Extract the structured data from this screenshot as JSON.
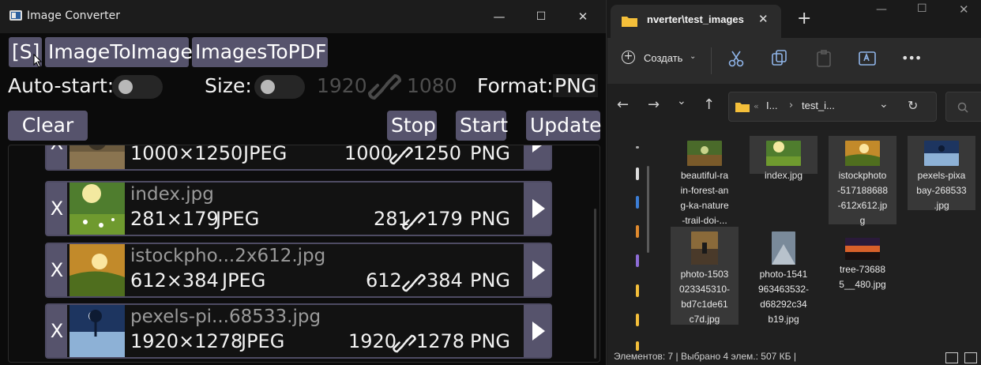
{
  "app": {
    "title": "Image Converter",
    "window_controls": {
      "minimize": "—",
      "maximize": "☐",
      "close": "✕"
    },
    "tabs": [
      "[S]",
      "ImageToImage",
      "ImagesToPDF"
    ],
    "auto_start_label": "Auto-start:",
    "size_label": "Size:",
    "size_width": "1920",
    "size_height": "1080",
    "format_label": "Format:",
    "format_value": "PNG",
    "buttons": {
      "clear_all": "Clear all",
      "stop": "Stop",
      "start": "Start",
      "update": "Update"
    },
    "items": [
      {
        "name": "",
        "x": "X",
        "src_dims": "1000×1250",
        "src_fmt": "JPEG",
        "out_w": "1000",
        "out_h": "1250",
        "out_fmt": "PNG"
      },
      {
        "name": "index.jpg",
        "x": "X",
        "src_dims": "281×179",
        "src_fmt": "JPEG",
        "out_w": "281",
        "out_h": "179",
        "out_fmt": "PNG"
      },
      {
        "name": "istockpho...2x612.jpg",
        "x": "X",
        "src_dims": "612×384",
        "src_fmt": "JPEG",
        "out_w": "612",
        "out_h": "384",
        "out_fmt": "PNG"
      },
      {
        "name": "pexels-pi...68533.jpg",
        "x": "X",
        "src_dims": "1920×1278",
        "src_fmt": "JPEG",
        "out_w": "1920",
        "out_h": "1278",
        "out_fmt": "PNG"
      }
    ]
  },
  "explorer": {
    "tab_title": "nverter\\test_images",
    "tab_close": "✕",
    "new_tab": "+",
    "create_label": "Создать",
    "more": "•••",
    "address": {
      "sep": "«",
      "part1": "I...",
      "arrow": "›",
      "part2": "test_i..."
    },
    "files": [
      {
        "name": "beautiful-rain-forest-ang-ka-nature-trail-doi-...",
        "lines": [
          "beautiful-ra",
          "in-forest-an",
          "g-ka-nature",
          "-trail-doi-..."
        ],
        "selected": false
      },
      {
        "name": "index.jpg",
        "lines": [
          "index.jpg"
        ],
        "selected": true
      },
      {
        "name": "istockphoto-517188688-612x612.jpg",
        "lines": [
          "istockphoto",
          "-517188688",
          "-612x612.jp",
          "g"
        ],
        "selected": true
      },
      {
        "name": "pexels-pixabay-268533.jpg",
        "lines": [
          "pexels-pixa",
          "bay-268533",
          ".jpg"
        ],
        "selected": true
      },
      {
        "name": "photo-1503023345310-bd7c1de61c7d.jpg",
        "lines": [
          "photo-1503",
          "023345310-",
          "bd7c1de61",
          "c7d.jpg"
        ],
        "selected": true
      },
      {
        "name": "photo-1541963463532-d68292c34b19.jpg",
        "lines": [
          "photo-1541",
          "963463532-",
          "d68292c34",
          "b19.jpg"
        ],
        "selected": false
      },
      {
        "name": "tree-736885_480.jpg",
        "lines": [
          "tree-73688",
          "5__480.jpg"
        ],
        "selected": false
      }
    ],
    "status": "Элементов: 7  |  Выбрано 4 элем.: 507 КБ  |"
  },
  "colors": {
    "accent_button": "#56536c",
    "app_bg": "#0b0b0b",
    "explorer_bg": "#202020"
  }
}
